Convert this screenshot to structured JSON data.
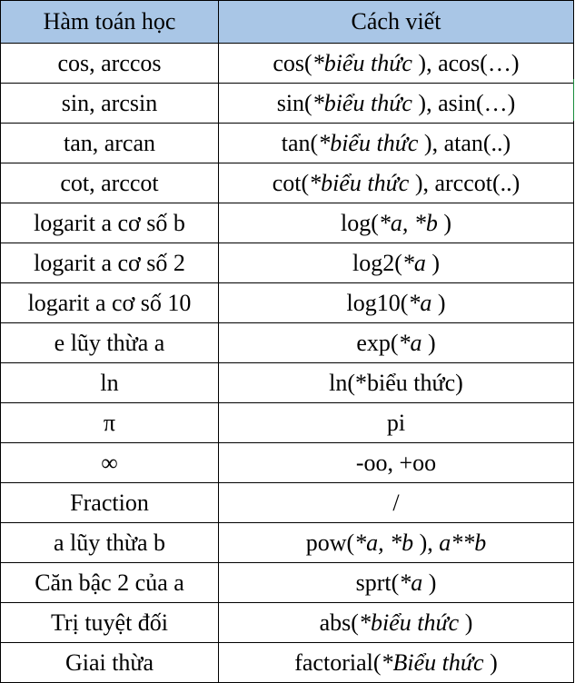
{
  "headers": {
    "col1": "Hàm toán học",
    "col2": "Cách viết"
  },
  "rows": [
    {
      "name": "cos, arccos",
      "syntax": [
        {
          "t": "cos(",
          "i": false
        },
        {
          "t": "*biểu thức",
          "i": true
        },
        {
          "t": " ), acos(…)",
          "i": false
        }
      ]
    },
    {
      "name": "sin, arcsin",
      "syntax": [
        {
          "t": "sin(",
          "i": false
        },
        {
          "t": "*biểu thức",
          "i": true
        },
        {
          "t": " ), asin(…)",
          "i": false
        }
      ]
    },
    {
      "name": "tan, arcan",
      "syntax": [
        {
          "t": "tan(",
          "i": false
        },
        {
          "t": "*biểu thức",
          "i": true
        },
        {
          "t": " ), atan(..)",
          "i": false
        }
      ]
    },
    {
      "name": "cot, arccot",
      "syntax": [
        {
          "t": "cot(",
          "i": false
        },
        {
          "t": "*biểu thức",
          "i": true
        },
        {
          "t": " ), arccot(..)",
          "i": false
        }
      ]
    },
    {
      "name": "logarit a cơ số b",
      "syntax": [
        {
          "t": "log(",
          "i": false
        },
        {
          "t": "*a, *b",
          "i": true
        },
        {
          "t": " )",
          "i": false
        }
      ]
    },
    {
      "name": "logarit a cơ số 2",
      "syntax": [
        {
          "t": "log2(",
          "i": false
        },
        {
          "t": "*a",
          "i": true
        },
        {
          "t": " )",
          "i": false
        }
      ]
    },
    {
      "name": "logarit a cơ số 10",
      "syntax": [
        {
          "t": "log10(",
          "i": false
        },
        {
          "t": "*a",
          "i": true
        },
        {
          "t": " )",
          "i": false
        }
      ]
    },
    {
      "name": "e lũy thừa a",
      "syntax": [
        {
          "t": "exp(",
          "i": false
        },
        {
          "t": "*a",
          "i": true
        },
        {
          "t": " )",
          "i": false
        }
      ]
    },
    {
      "name": "ln",
      "syntax": [
        {
          "t": "ln(*biểu thức)",
          "i": false
        }
      ]
    },
    {
      "name": "π",
      "syntax": [
        {
          "t": "pi",
          "i": false
        }
      ]
    },
    {
      "name": "∞",
      "syntax": [
        {
          "t": "-oo, +oo",
          "i": false
        }
      ]
    },
    {
      "name": "Fraction",
      "syntax": [
        {
          "t": "/",
          "i": false
        }
      ]
    },
    {
      "name": "a lũy thừa b",
      "syntax": [
        {
          "t": "pow(",
          "i": false
        },
        {
          "t": "*a, *b",
          "i": true
        },
        {
          "t": " ), ",
          "i": false
        },
        {
          "t": "a**b",
          "i": true
        }
      ]
    },
    {
      "name": "Căn bậc 2 của a",
      "syntax": [
        {
          "t": "sprt(",
          "i": false
        },
        {
          "t": "*a",
          "i": true
        },
        {
          "t": " )",
          "i": false
        }
      ]
    },
    {
      "name": "Trị tuyệt đối",
      "syntax": [
        {
          "t": "abs(",
          "i": false
        },
        {
          "t": "*biểu thức",
          "i": true
        },
        {
          "t": " )",
          "i": false
        }
      ]
    },
    {
      "name": "Giai thừa",
      "syntax": [
        {
          "t": "factorial(",
          "i": false
        },
        {
          "t": "*Biểu thức",
          "i": true
        },
        {
          "t": " )",
          "i": false
        }
      ]
    }
  ],
  "colors": {
    "header_bg": "#a9c6e6",
    "border": "#000000",
    "gridline": "#1a8c3c"
  }
}
